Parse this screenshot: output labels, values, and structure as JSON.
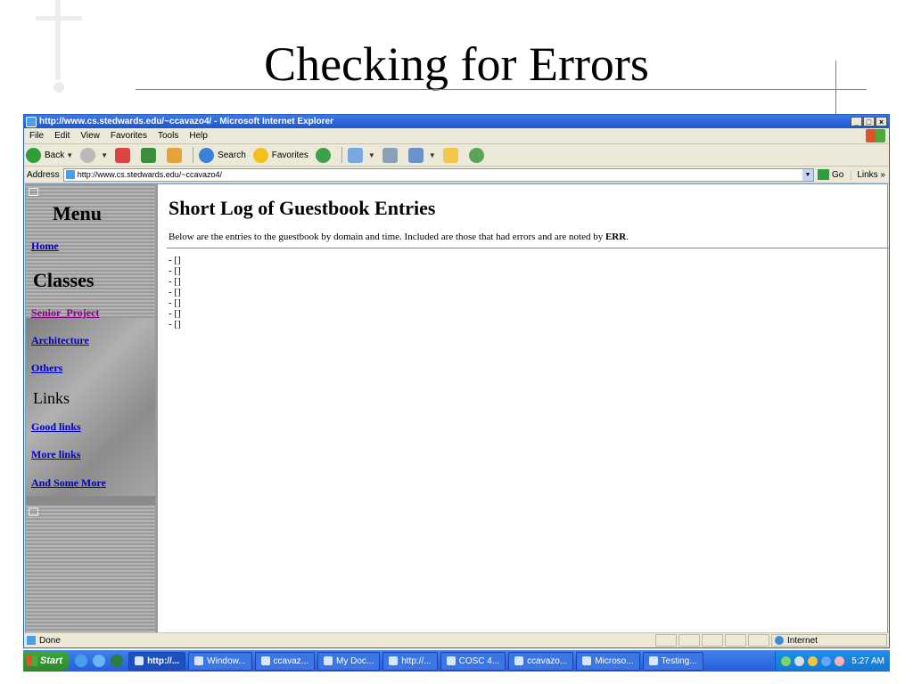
{
  "slide": {
    "title": "Checking for Errors"
  },
  "window": {
    "title": "http://www.cs.stedwards.edu/~ccavazo4/ - Microsoft Internet Explorer",
    "controls": {
      "minimize": "_",
      "maximize": "□",
      "close": "×"
    }
  },
  "menubar": {
    "items": [
      "File",
      "Edit",
      "View",
      "Favorites",
      "Tools",
      "Help"
    ]
  },
  "toolbar": {
    "back": "Back",
    "search": "Search",
    "favorites": "Favorites"
  },
  "addressbar": {
    "label": "Address",
    "url": "http://www.cs.stedwards.edu/~ccavazo4/",
    "go": "Go",
    "links": "Links »"
  },
  "leftframe": {
    "menu_heading": "Menu",
    "home": "Home",
    "classes_heading": "Classes",
    "senior_project": "Senior_Project",
    "architecture": "Architecture",
    "others": "Others",
    "links_heading": "Links",
    "good_links": "Good links",
    "more_links": "More links",
    "and_some_more": "And Some More"
  },
  "main": {
    "heading": "Short Log of Guestbook Entries",
    "intro_text": "Below are the entries to the guestbook by domain and time. Included are those that had errors and are noted by ",
    "intro_bold": "ERR",
    "intro_end": ".",
    "entries": [
      "- []",
      "- []",
      "- []",
      "- []",
      "- []",
      "- []",
      "- []"
    ]
  },
  "statusbar": {
    "text": "Done",
    "zone": "Internet"
  },
  "taskbar": {
    "start": "Start",
    "tasks": [
      "http://...",
      "Window...",
      "ccavaz...",
      "My Doc...",
      "http://...",
      "COSC 4...",
      "ccavazo...",
      "Microso...",
      "Testing..."
    ],
    "clock": "5:27 AM"
  }
}
